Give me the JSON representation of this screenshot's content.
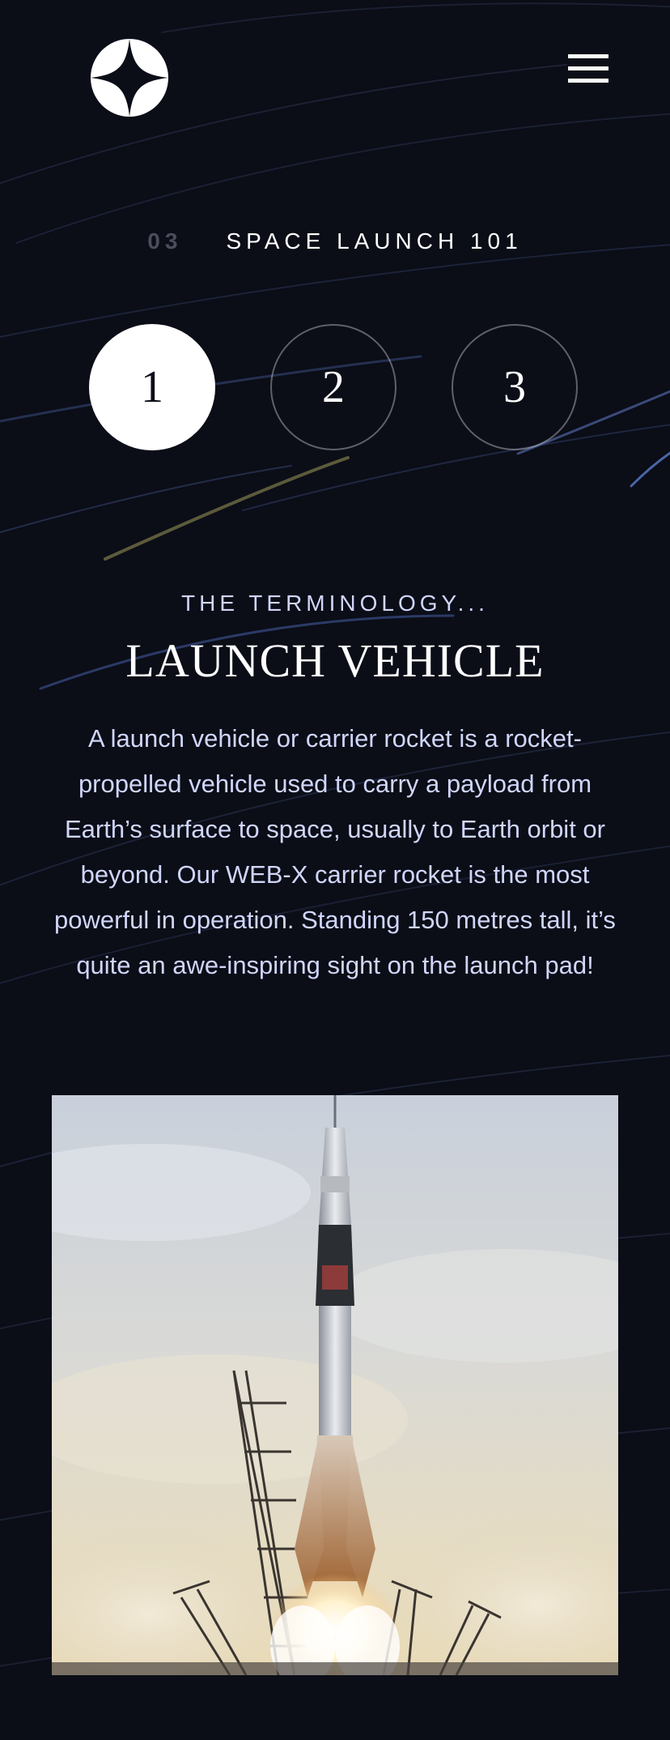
{
  "header": {
    "logo_icon": "star-logo-icon",
    "menu_icon": "hamburger-menu-icon"
  },
  "heading": {
    "number": "03",
    "title": "SPACE LAUNCH 101"
  },
  "steps": [
    {
      "label": "1",
      "active": true
    },
    {
      "label": "2",
      "active": false
    },
    {
      "label": "3",
      "active": false
    }
  ],
  "content": {
    "eyebrow": "THE TERMINOLOGY...",
    "title": "LAUNCH VEHICLE",
    "description": "A launch vehicle or carrier rocket is a rocket-propelled vehicle used to carry a payload from Earth’s surface to space, usually to Earth orbit or beyond. Our WEB-X carrier rocket is the most powerful in operation. Standing 150 metres tall, it’s quite an awe-inspiring sight on the launch pad!"
  },
  "colors": {
    "background": "#0b0d17",
    "accent_text": "#d0d6f9",
    "white": "#ffffff"
  }
}
